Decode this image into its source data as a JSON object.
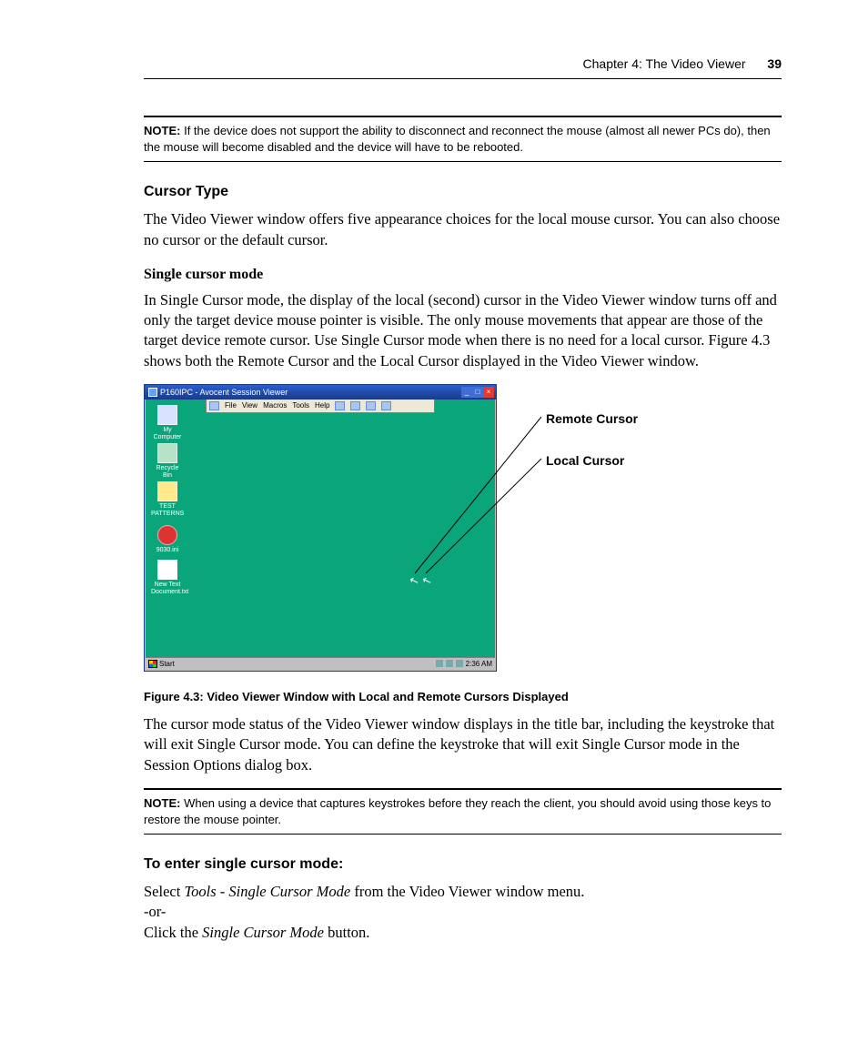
{
  "header": {
    "chapter": "Chapter 4: The Video Viewer",
    "page_number": "39"
  },
  "note1": {
    "label": "NOTE:",
    "text": "If the device does not support the ability to disconnect and reconnect the mouse (almost all newer PCs do), then the mouse will become disabled and the device will have to be rebooted."
  },
  "cursor_type": {
    "heading": "Cursor Type",
    "p1": "The Video Viewer window offers five appearance choices for the local mouse cursor. You can also choose no cursor or the default cursor."
  },
  "single_cursor": {
    "heading": "Single cursor mode",
    "p1": "In Single Cursor mode, the display of the local (second) cursor in the Video Viewer window turns off and only the target device mouse pointer is visible. The only mouse movements that appear are those of the target device remote cursor. Use Single Cursor mode when there is no need for a local cursor. Figure 4.3 shows both the Remote Cursor and the Local Cursor displayed in the Video Viewer window."
  },
  "figure": {
    "window_title": "P160IPC - Avocent Session Viewer",
    "menus": [
      "File",
      "View",
      "Macros",
      "Tools",
      "Help"
    ],
    "icons": {
      "my_computer": "My Computer",
      "recycle_bin": "Recycle Bin",
      "test_patterns": "TEST PATTERNS",
      "rose_ini": "9030.ini",
      "new_text": "New Text Document.txt"
    },
    "taskbar": {
      "start": "Start",
      "time": "2:36 AM"
    },
    "callout_remote": "Remote Cursor",
    "callout_local": "Local Cursor",
    "caption": "Figure 4.3: Video Viewer Window with Local and Remote Cursors Displayed"
  },
  "after_fig": {
    "p1": "The cursor mode status of the Video Viewer window displays in the title bar, including the keystroke that will exit Single Cursor mode. You can define the keystroke that will exit Single Cursor mode in the Session Options dialog box."
  },
  "note2": {
    "label": "NOTE:",
    "text": "When using a device that captures keystrokes before they reach the client, you should avoid using those keys to restore the mouse pointer."
  },
  "enter_single": {
    "heading": "To enter single cursor mode:",
    "line1_lead": "Select ",
    "line1_italic": "Tools - Single Cursor Mode",
    "line1_tail": " from the Video Viewer window menu.",
    "line_or": "-or-",
    "line2_lead": "Click the ",
    "line2_italic": "Single Cursor Mode",
    "line2_tail": " button."
  }
}
